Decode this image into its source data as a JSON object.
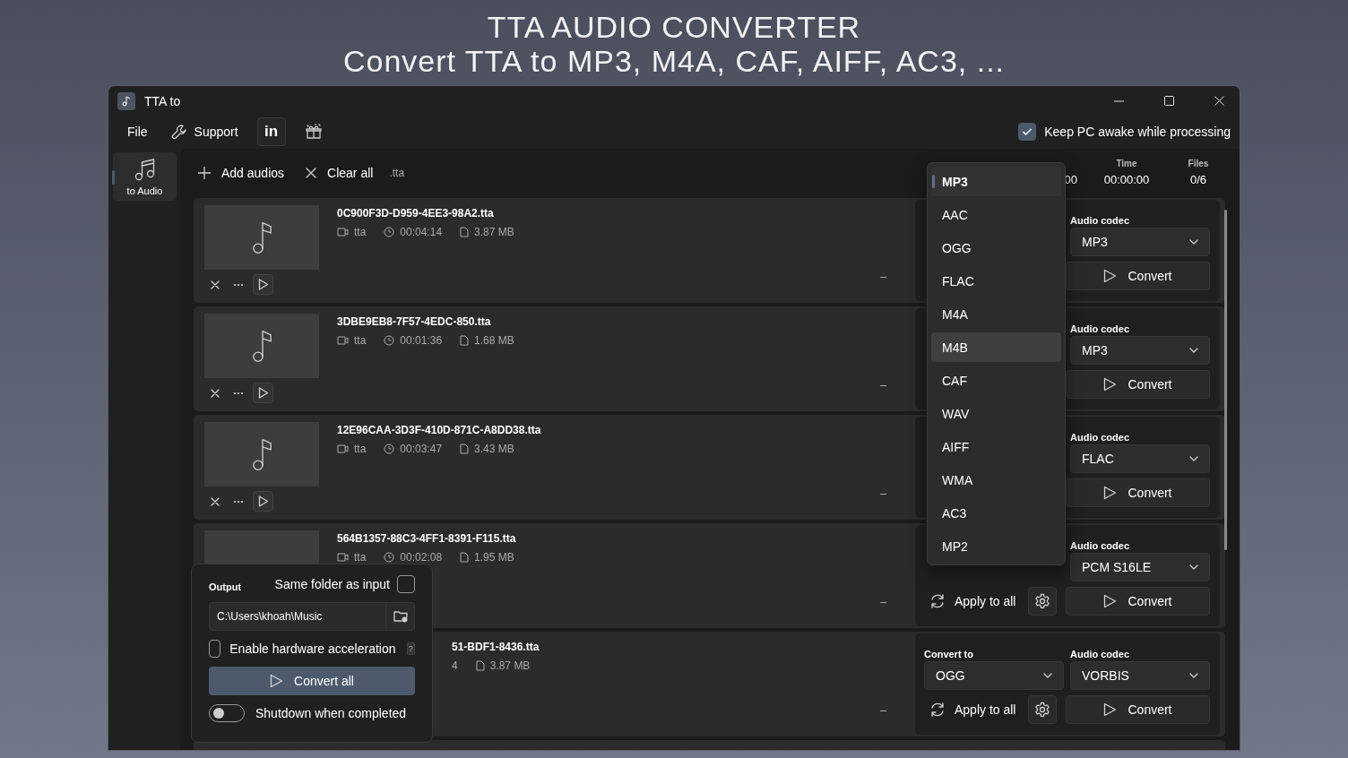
{
  "banner": {
    "title": "TTA AUDIO CONVERTER",
    "subtitle": "Convert TTA to MP3, M4A, CAF, AIFF, AC3, ..."
  },
  "window": {
    "title": "TTA to"
  },
  "menu": [
    {
      "kind": "text",
      "label": "File"
    },
    {
      "kind": "wrench",
      "label": "Support"
    },
    {
      "kind": "badge",
      "label": "in"
    },
    {
      "kind": "gift"
    }
  ],
  "keep_awake": {
    "label": "Keep PC awake while processing",
    "checked": true
  },
  "nav": [
    {
      "label": "to Audio",
      "selected": true
    }
  ],
  "toolbar": {
    "add": "Add audios",
    "clear": "Clear all",
    "extension": ".tta"
  },
  "stats": [
    {
      "value": "00"
    },
    {
      "label": "Time",
      "value": "00:00:00"
    },
    {
      "label": "Files",
      "value": "0/6"
    }
  ],
  "files": [
    {
      "name": "0C900F3D-D959-4EE3-98A2.tta",
      "format": "tta",
      "duration": "00:04:14",
      "size": "3.87 MB",
      "status": "–",
      "actions": true,
      "codec_label": "Audio codec",
      "codec": "MP3",
      "convert": "Convert"
    },
    {
      "name": "3DBE9EB8-7F57-4EDC-850.tta",
      "format": "tta",
      "duration": "00:01:36",
      "size": "1.68 MB",
      "status": "–",
      "actions": true,
      "codec_label": "Audio codec",
      "codec": "MP3",
      "convert": "Convert"
    },
    {
      "name": "12E96CAA-3D3F-410D-871C-A8DD38.tta",
      "format": "tta",
      "duration": "00:03:47",
      "size": "3.43 MB",
      "status": "–",
      "actions": true,
      "codec_label": "Audio codec",
      "codec": "FLAC",
      "convert": "Convert"
    },
    {
      "name": "564B1357-88C3-4FF1-8391-F115.tta",
      "format": "tta",
      "duration": "00:02:08",
      "size": "1.95 MB",
      "status": "–",
      "thumb_icon": false,
      "codec_label": "Audio codec",
      "codec": "PCM S16LE",
      "apply": "Apply to all",
      "convert": "Convert"
    },
    {
      "name": "51-BDF1-8436.tta",
      "covered": true,
      "duration": "4",
      "size": "3.87 MB",
      "status": "–",
      "convert_to_label": "Convert to",
      "convert_to": "OGG",
      "codec_label": "Audio codec",
      "codec": "VORBIS",
      "apply": "Apply to all",
      "convert": "Convert"
    }
  ],
  "format_menu": [
    {
      "label": "MP3",
      "selected": true,
      "hovered": false
    },
    {
      "label": "AAC",
      "selected": false,
      "hovered": false
    },
    {
      "label": "OGG",
      "selected": false,
      "hovered": false
    },
    {
      "label": "FLAC",
      "selected": false,
      "hovered": false
    },
    {
      "label": "M4A",
      "selected": false,
      "hovered": false
    },
    {
      "label": "M4B",
      "selected": false,
      "hovered": true
    },
    {
      "label": "CAF",
      "selected": false,
      "hovered": false
    },
    {
      "label": "WAV",
      "selected": false,
      "hovered": false
    },
    {
      "label": "AIFF",
      "selected": false,
      "hovered": false
    },
    {
      "label": "WMA",
      "selected": false,
      "hovered": false
    },
    {
      "label": "AC3",
      "selected": false,
      "hovered": false
    },
    {
      "label": "MP2",
      "selected": false,
      "hovered": false
    }
  ],
  "output": {
    "label": "Output",
    "same_folder": {
      "label": "Same folder as input",
      "checked": false
    },
    "path": "C:\\Users\\khoah\\Music",
    "hw_accel": {
      "label": "Enable hardware acceleration",
      "checked": false,
      "help": "?"
    },
    "convert_all": "Convert all",
    "shutdown": {
      "label": "Shutdown when completed",
      "on": false
    }
  }
}
